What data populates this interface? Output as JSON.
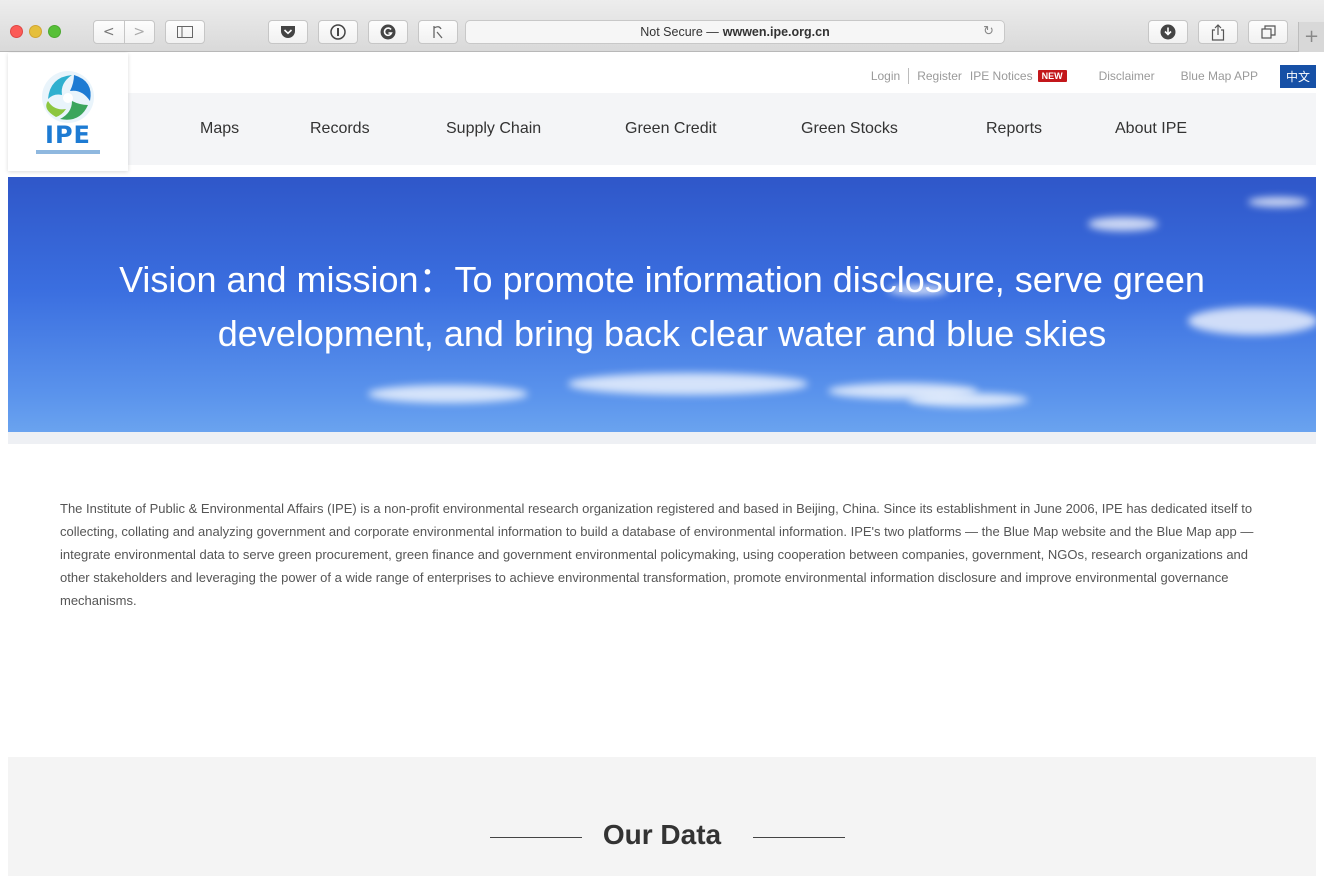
{
  "browser": {
    "address_prefix": "Not Secure — ",
    "address_host": "wwwen.ipe.org.cn",
    "nav_back": "<",
    "nav_forward": ">",
    "newtab": "+"
  },
  "logo": {
    "text": "IPE"
  },
  "top_links": {
    "login": "Login",
    "register": "Register",
    "notices": "IPE Notices",
    "new_badge": "NEW",
    "disclaimer": "Disclaimer",
    "app": "Blue Map APP",
    "language": "中文"
  },
  "nav": [
    "Maps",
    "Records",
    "Supply Chain",
    "Green Credit",
    "Green Stocks",
    "Reports",
    "About IPE"
  ],
  "hero": {
    "line1": "Vision and mission：To promote information disclosure, serve green",
    "line2": "development, and bring back clear water and blue skies"
  },
  "intro": "The Institute of Public & Environmental Affairs (IPE) is a non-profit environmental research organization registered and based in Beijing, China. Since its establishment in June 2006, IPE has dedicated itself to collecting, collating and analyzing government and corporate environmental information to build a database of environmental information. IPE's two platforms — the Blue Map website and the Blue Map app — integrate environmental data to serve green procurement, green finance and government environmental policymaking, using cooperation between companies, government, NGOs, research organizations and other stakeholders and leveraging the power of a wide range of enterprises to achieve environmental transformation, promote environmental information disclosure and improve environmental governance mechanisms.",
  "data_section": {
    "heading": "Our Data"
  },
  "colors": {
    "brand_blue": "#1d7bd3",
    "nav_bg": "#f4f5f7",
    "badge_red": "#c3171b",
    "lang_blue": "#1650a6"
  }
}
